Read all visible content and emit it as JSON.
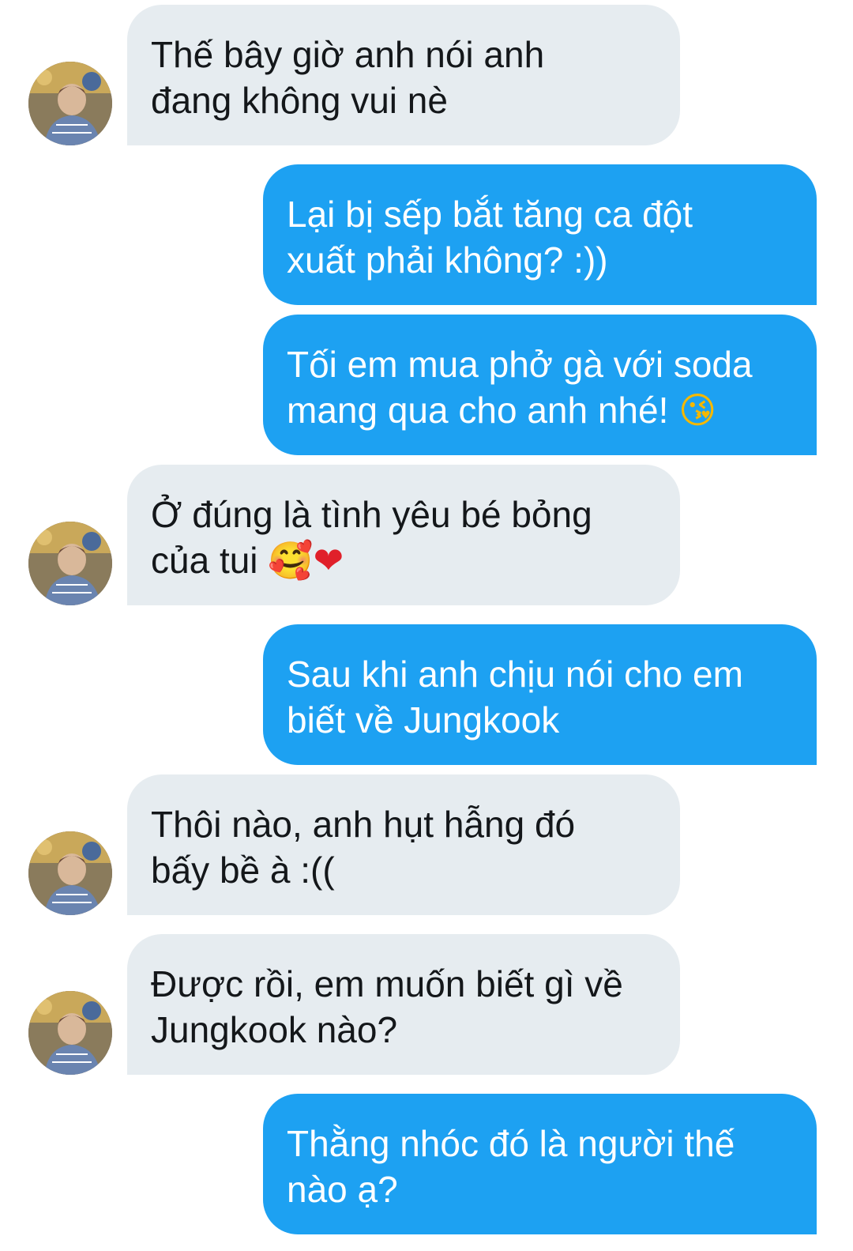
{
  "messages": [
    {
      "side": "incoming",
      "lines": [
        "Thế bây giờ anh nói anh",
        "đang không vui nè"
      ]
    },
    {
      "side": "outgoing",
      "lines": [
        "Lại bị sếp bắt tăng ca đột",
        "xuất phải không? :))"
      ]
    },
    {
      "side": "outgoing",
      "lines": [
        "Tối em mua phở gà với soda",
        "mang qua cho anh nhé!"
      ],
      "emoji": "face-blowing-kiss-icon"
    },
    {
      "side": "incoming",
      "lines": [
        "Ở đúng là tình yêu bé bỏng",
        "của tui"
      ],
      "emoji": [
        "smiling-face-with-hearts-icon",
        "red-heart-icon"
      ]
    },
    {
      "side": "outgoing",
      "lines": [
        "Sau khi anh chịu nói cho em",
        "biết về Jungkook"
      ]
    },
    {
      "side": "incoming",
      "lines": [
        "Thôi nào, anh hụt hẫng đó",
        "bấy bề à :(("
      ]
    },
    {
      "side": "incoming",
      "lines": [
        "Được rồi, em muốn biết gì về",
        "Jungkook nào?"
      ]
    },
    {
      "side": "outgoing",
      "lines": [
        "Thằng nhóc đó là người thế",
        "nào ạ?"
      ]
    }
  ],
  "colors": {
    "incoming_bubble": "#e6ecf0",
    "incoming_text": "#14171a",
    "outgoing_bubble": "#1da1f2",
    "outgoing_text": "#ffffff"
  },
  "avatar": {
    "icon": "contact-avatar"
  }
}
